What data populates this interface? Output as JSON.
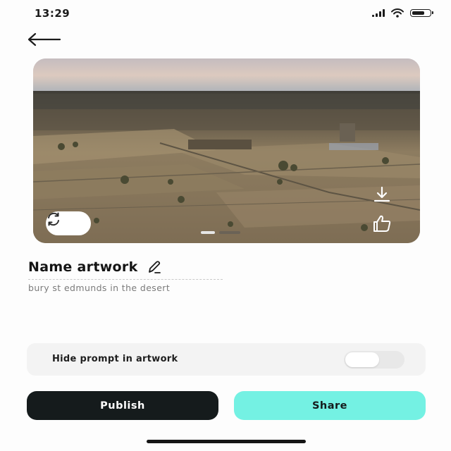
{
  "status_bar": {
    "time": "13:29",
    "battery_level": 0.75
  },
  "artwork": {
    "page_count": 2,
    "active_page": 1,
    "colors": {
      "dot_active": "#e6e6e6",
      "dot_inactive": "#6b6256"
    }
  },
  "title": {
    "text": "Name artwork"
  },
  "prompt": {
    "text": "bury st edmunds in the desert"
  },
  "hide_prompt": {
    "label": "Hide prompt in artwork",
    "enabled": false
  },
  "actions": {
    "publish_label": "Publish",
    "share_label": "Share"
  },
  "colors": {
    "accent": "#74f1e3",
    "dark": "#151b1c"
  },
  "icons": [
    "back-arrow-icon",
    "regenerate-icon",
    "download-icon",
    "thumbs-up-icon",
    "pencil-icon"
  ]
}
